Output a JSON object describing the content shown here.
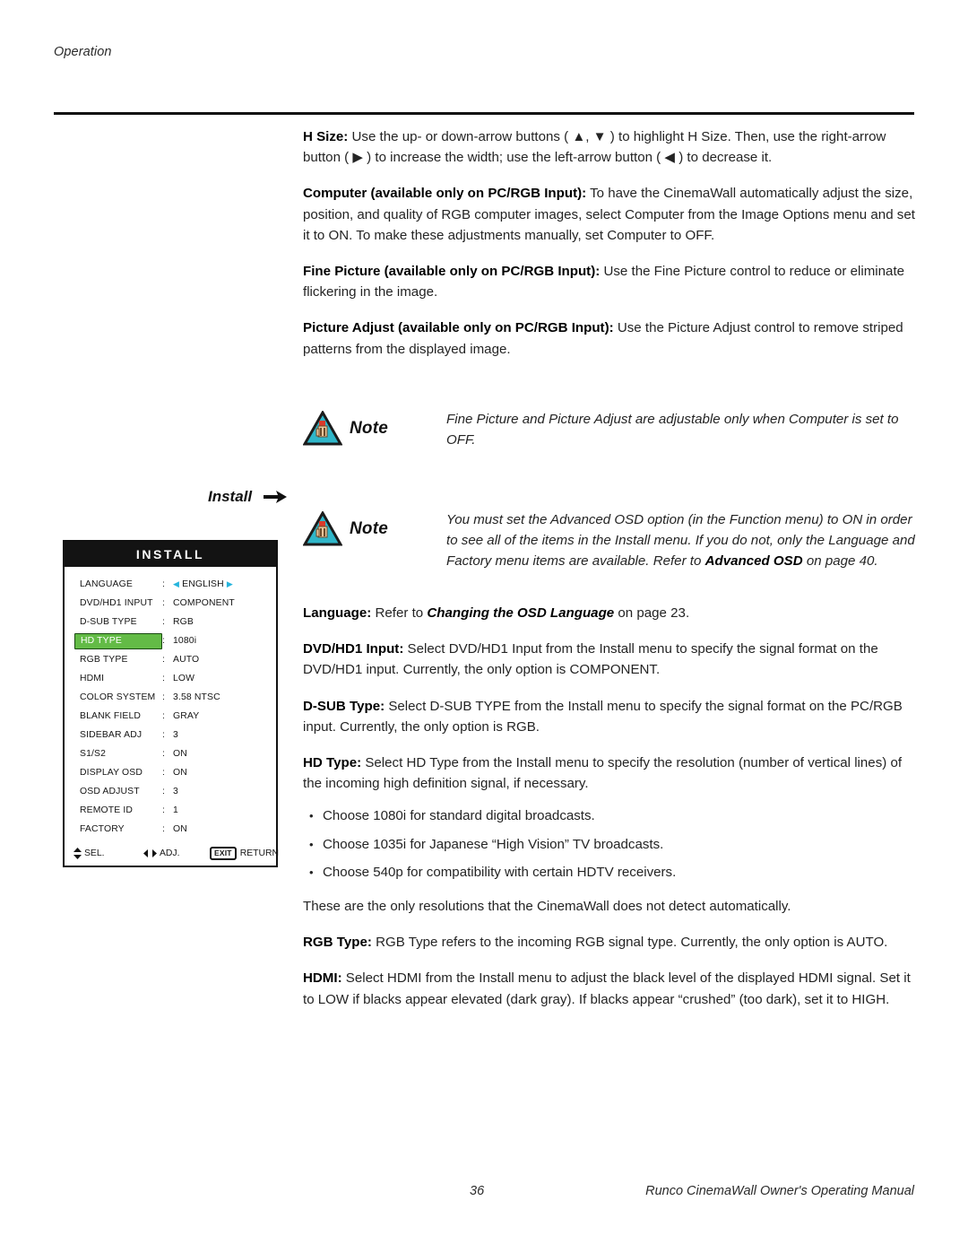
{
  "page": {
    "running_header": "Operation",
    "page_number": "36",
    "footer_title": "Runco CinemaWall Owner's Operating Manual"
  },
  "body": {
    "paragraphs": [
      {
        "id": "h-size",
        "lead": "H Size:",
        "text": " Use the up- or down-arrow buttons ( ▲, ▼ ) to highlight H Size. Then, use the right-arrow button ( ▶ ) to increase the width; use the left-arrow button ( ◀ ) to decrease it."
      },
      {
        "id": "computer",
        "lead": "Computer (available only on PC/RGB Input):",
        "text": " To have the CinemaWall automatically adjust the size, position, and quality of RGB computer images, select Computer from the Image Options menu and set it to ON. To make these adjustments manually, set Computer to OFF."
      },
      {
        "id": "fine-picture",
        "lead": "Fine Picture (available only on PC/RGB Input):",
        "text": " Use the Fine Picture control to reduce or eliminate flickering in the image."
      },
      {
        "id": "picture-adjust",
        "lead": "Picture Adjust (available only on PC/RGB Input):",
        "text": " Use the Picture Adjust control to remove striped patterns from the displayed image."
      }
    ],
    "paragraphs_lower": [
      {
        "id": "language",
        "lead": "Language:",
        "mid": " Refer to ",
        "emphasis": "Changing the OSD Language",
        "tail": " on page 23."
      },
      {
        "id": "dvd-hd1-input",
        "lead": "DVD/HD1 Input:",
        "text": " Select DVD/HD1 Input from the Install menu to specify the signal format on the DVD/HD1 input. Currently, the only option is COMPONENT."
      },
      {
        "id": "d-sub-type",
        "lead": "D-SUB Type:",
        "text": " Select D-SUB TYPE from the Install menu to specify the signal format on the PC/RGB input. Currently, the only option is RGB."
      },
      {
        "id": "hd-type",
        "lead": "HD Type:",
        "text": " Select HD Type from the Install menu to specify the resolution (number of vertical lines) of the incoming high definition signal, if necessary."
      }
    ],
    "bullets": [
      "Choose 1080i for standard digital broadcasts.",
      "Choose 1035i for Japanese “High Vision” TV broadcasts.",
      "Choose 540p for compatibility with certain HDTV receivers."
    ],
    "paragraphs_tail": [
      {
        "id": "resolutions-note",
        "lead": "",
        "text": "These are the only resolutions that the CinemaWall does not detect automatically."
      },
      {
        "id": "rgb-type",
        "lead": "RGB Type:",
        "text": " RGB Type refers to the incoming RGB signal type. Currently, the only option is AUTO."
      },
      {
        "id": "hdmi",
        "lead": "HDMI:",
        "text": " Select HDMI from the Install menu to adjust the black level of the displayed HDMI signal. Set it to LOW if blacks appear elevated (dark gray). If blacks appear “crushed” (too dark), set it to HIGH."
      }
    ]
  },
  "notes": [
    {
      "id": "note-computer-off",
      "label": "Note",
      "text": "Fine Picture and Picture Adjust are adjustable only when Computer is set to OFF."
    },
    {
      "id": "note-advanced-osd",
      "label": "Note",
      "text_before": "You must set the Advanced OSD option (in the Function menu) to ON in order to see all of the items in the Install menu. If you do not, only the Language and Factory menu items are available. Refer to ",
      "emphasis": "Advanced OSD",
      "text_after": " on page 40."
    }
  ],
  "install_callout": {
    "label": "Install"
  },
  "osd": {
    "title": "INSTALL",
    "selected_row": "HD TYPE",
    "colors": {
      "highlight_green": "#63bb46",
      "highlight_border": "#184a10",
      "arrow_cyan": "#26b4dc",
      "title_bar": "#131313"
    },
    "rows": [
      {
        "label": "LANGUAGE",
        "colon": ":",
        "value": "ENGLISH",
        "arrows": true
      },
      {
        "label": "DVD/HD1 INPUT",
        "colon": ":",
        "value": "COMPONENT"
      },
      {
        "label": "D-SUB TYPE",
        "colon": ":",
        "value": "RGB"
      },
      {
        "label": "HD TYPE",
        "colon": ":",
        "value": "1080i",
        "selected": true
      },
      {
        "label": "RGB TYPE",
        "colon": ":",
        "value": "AUTO"
      },
      {
        "label": "HDMI",
        "colon": ":",
        "value": "LOW"
      },
      {
        "label": "COLOR SYSTEM",
        "colon": ":",
        "value": "3.58 NTSC"
      },
      {
        "label": "BLANK FIELD",
        "colon": ":",
        "value": "GRAY"
      },
      {
        "label": "SIDEBAR ADJ",
        "colon": ":",
        "value": "3"
      },
      {
        "label": "S1/S2",
        "colon": ":",
        "value": "ON"
      },
      {
        "label": "DISPLAY OSD",
        "colon": ":",
        "value": "ON"
      },
      {
        "label": "OSD ADJUST",
        "colon": ":",
        "value": "3"
      },
      {
        "label": "REMOTE ID",
        "colon": ":",
        "value": "1"
      },
      {
        "label": "FACTORY",
        "colon": ":",
        "value": "ON"
      }
    ],
    "footer": {
      "select_label": "SEL.",
      "adjust_label": "ADJ.",
      "exit_label": "EXIT",
      "return_label": "RETURN"
    }
  }
}
